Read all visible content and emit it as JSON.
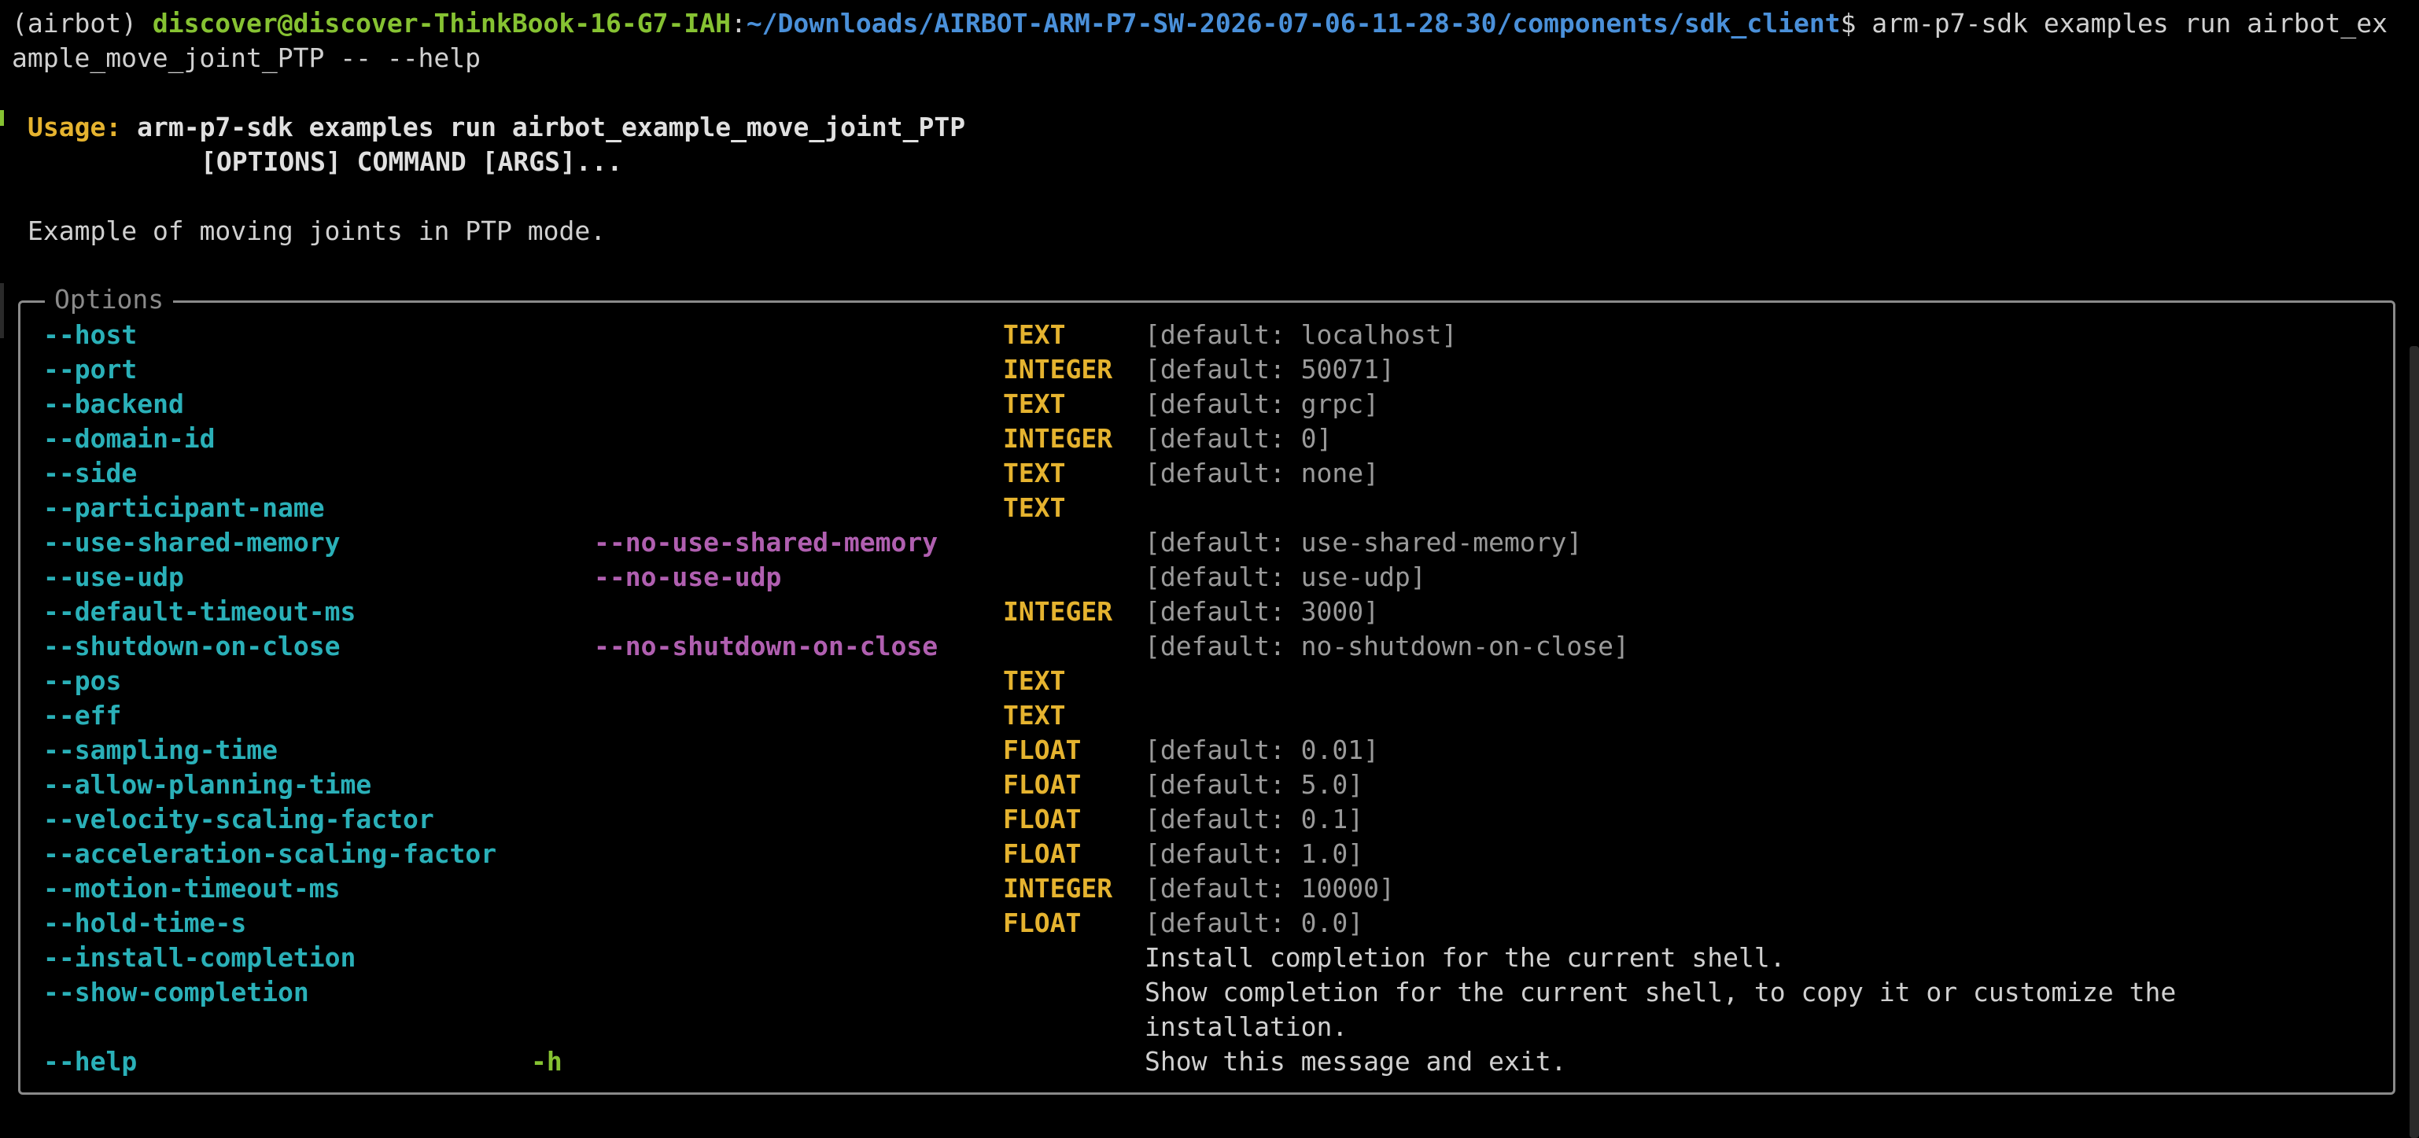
{
  "prompt": {
    "env": "(airbot)",
    "user_host": "discover@discover-ThinkBook-16-G7-IAH",
    "separator": ":",
    "path": "~/Downloads/AIRBOT-ARM-P7-SW-2026-07-06-11-28-30/components/sdk_client",
    "dollar": "$",
    "command_line1": " arm-p7-sdk examples run airbot_ex",
    "command_line2": "ample_move_joint_PTP -- --help"
  },
  "usage": {
    "label": "Usage:",
    "line1": "arm-p7-sdk examples run airbot_example_move_joint_PTP",
    "line2": "[OPTIONS] COMMAND [ARGS]..."
  },
  "description": "Example of moving joints in PTP mode.",
  "options_panel": {
    "title": "Options",
    "rows": [
      {
        "opt": "--host",
        "neg": "",
        "short": "",
        "type": "TEXT",
        "help": "[default: localhost]",
        "help_is_default": true
      },
      {
        "opt": "--port",
        "neg": "",
        "short": "",
        "type": "INTEGER",
        "help": "[default: 50071]",
        "help_is_default": true
      },
      {
        "opt": "--backend",
        "neg": "",
        "short": "",
        "type": "TEXT",
        "help": "[default: grpc]",
        "help_is_default": true
      },
      {
        "opt": "--domain-id",
        "neg": "",
        "short": "",
        "type": "INTEGER",
        "help": "[default: 0]",
        "help_is_default": true
      },
      {
        "opt": "--side",
        "neg": "",
        "short": "",
        "type": "TEXT",
        "help": "[default: none]",
        "help_is_default": true
      },
      {
        "opt": "--participant-name",
        "neg": "",
        "short": "",
        "type": "TEXT",
        "help": "",
        "help_is_default": true
      },
      {
        "opt": "--use-shared-memory",
        "neg": "--no-use-shared-memory",
        "short": "",
        "type": "",
        "help": "[default: use-shared-memory]",
        "help_is_default": true
      },
      {
        "opt": "--use-udp",
        "neg": "--no-use-udp",
        "short": "",
        "type": "",
        "help": "[default: use-udp]",
        "help_is_default": true
      },
      {
        "opt": "--default-timeout-ms",
        "neg": "",
        "short": "",
        "type": "INTEGER",
        "help": "[default: 3000]",
        "help_is_default": true
      },
      {
        "opt": "--shutdown-on-close",
        "neg": "--no-shutdown-on-close",
        "short": "",
        "type": "",
        "help": "[default: no-shutdown-on-close]",
        "help_is_default": true
      },
      {
        "opt": "--pos",
        "neg": "",
        "short": "",
        "type": "TEXT",
        "help": "",
        "help_is_default": true
      },
      {
        "opt": "--eff",
        "neg": "",
        "short": "",
        "type": "TEXT",
        "help": "",
        "help_is_default": true
      },
      {
        "opt": "--sampling-time",
        "neg": "",
        "short": "",
        "type": "FLOAT",
        "help": "[default: 0.01]",
        "help_is_default": true
      },
      {
        "opt": "--allow-planning-time",
        "neg": "",
        "short": "",
        "type": "FLOAT",
        "help": "[default: 5.0]",
        "help_is_default": true
      },
      {
        "opt": "--velocity-scaling-factor",
        "neg": "",
        "short": "",
        "type": "FLOAT",
        "help": "[default: 0.1]",
        "help_is_default": true
      },
      {
        "opt": "--acceleration-scaling-factor",
        "neg": "",
        "short": "",
        "type": "FLOAT",
        "help": "[default: 1.0]",
        "help_is_default": true
      },
      {
        "opt": "--motion-timeout-ms",
        "neg": "",
        "short": "",
        "type": "INTEGER",
        "help": "[default: 10000]",
        "help_is_default": true
      },
      {
        "opt": "--hold-time-s",
        "neg": "",
        "short": "",
        "type": "FLOAT",
        "help": "[default: 0.0]",
        "help_is_default": true
      },
      {
        "opt": "--install-completion",
        "neg": "",
        "short": "",
        "type": "",
        "help": "Install completion for the current shell.",
        "help_is_default": false
      },
      {
        "opt": "--show-completion",
        "neg": "",
        "short": "",
        "type": "",
        "help": "Show completion for the current shell, to copy it or customize the",
        "help_is_default": false
      },
      {
        "opt": "",
        "neg": "",
        "short": "",
        "type": "",
        "help": "installation.",
        "help_is_default": false
      },
      {
        "opt": "--help",
        "neg": "",
        "short": "-h",
        "type": "",
        "help": "Show this message and exit.",
        "help_is_default": false
      }
    ]
  },
  "colors": {
    "background": "#000000",
    "user_host": "#86c232",
    "path": "#4a90d9",
    "usage_label": "#e5b32f",
    "option": "#2ab0b8",
    "negation": "#b05fb0",
    "type": "#e5b32f",
    "default_text": "#9a9a9a"
  }
}
